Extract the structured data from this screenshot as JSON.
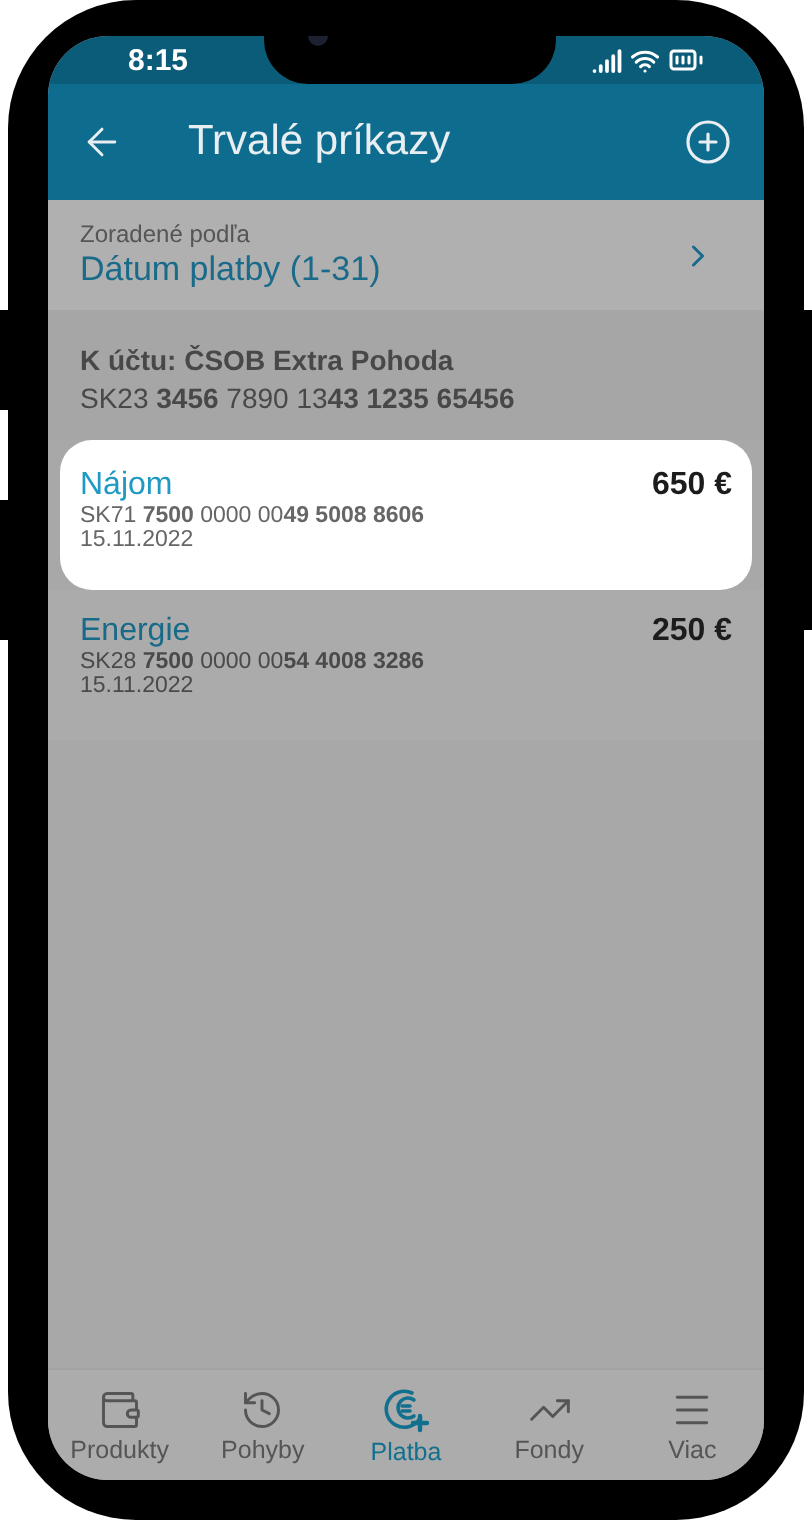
{
  "status_bar": {
    "time": "8:15"
  },
  "header": {
    "title": "Trvalé príkazy"
  },
  "sort": {
    "label": "Zoradené podľa",
    "value": "Dátum platby (1-31)"
  },
  "account": {
    "title": "K účtu: ČSOB Extra Pohoda",
    "iban": "SK23 **3456** 7890 13**43 1235 65456**"
  },
  "orders": [
    {
      "name": "Nájom",
      "amount": "650 €",
      "iban": "SK71 **7500** 0000 00**49 5008 8606**",
      "date": "15.11.2022",
      "highlighted": true
    },
    {
      "name": "Energie",
      "amount": "250 €",
      "iban": "SK28 **7500** 0000 00**54 4008 3286**",
      "date": "15.11.2022",
      "highlighted": false
    }
  ],
  "nav": [
    {
      "label": "Produkty",
      "selected": false
    },
    {
      "label": "Pohyby",
      "selected": false
    },
    {
      "label": "Platba",
      "selected": true
    },
    {
      "label": "Fondy",
      "selected": false
    },
    {
      "label": "Viac",
      "selected": false
    }
  ]
}
